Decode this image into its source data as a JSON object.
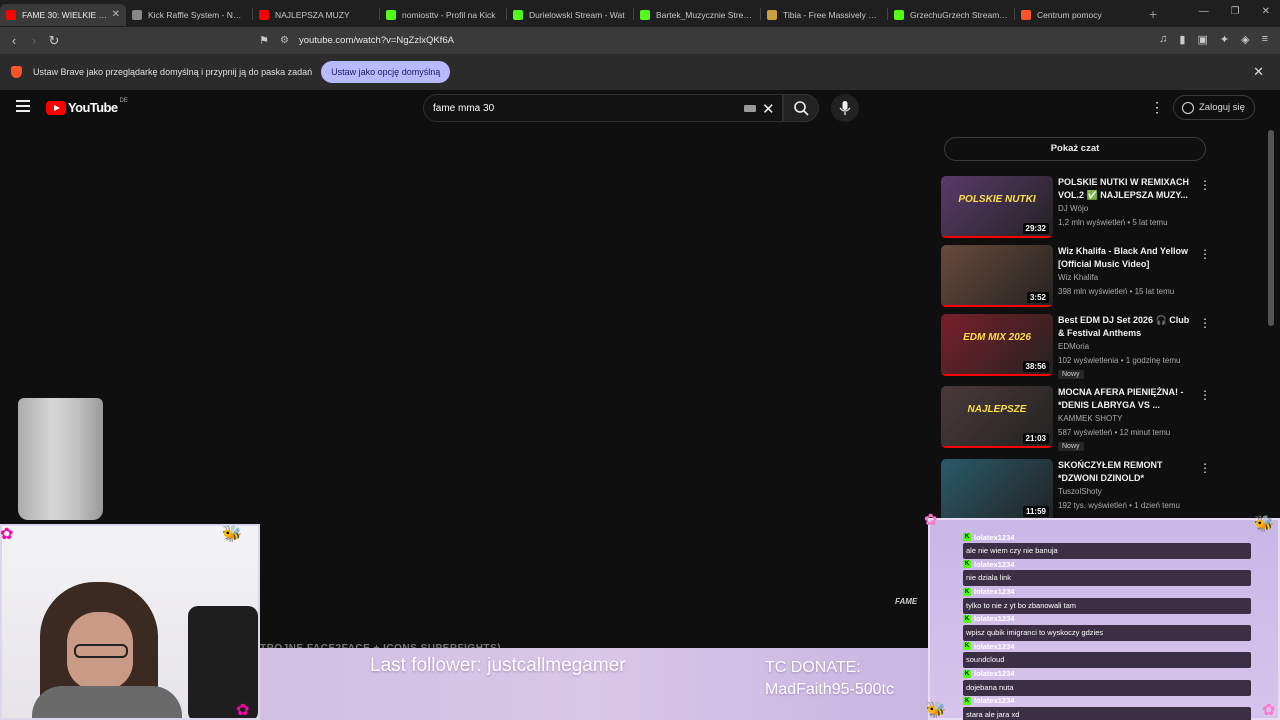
{
  "browser": {
    "tabs": [
      {
        "title": "FAME 30: WIELKIE OT",
        "color": "#ff0000",
        "active": true
      },
      {
        "title": "Kick Raffle System - Narzę",
        "color": "#888888"
      },
      {
        "title": "NAJLEPSZA MUZY",
        "color": "#ff0000"
      },
      {
        "title": "nomiosttv - Profil na Kick",
        "color": "#53fc18"
      },
      {
        "title": "Durielowski Stream - Wat",
        "color": "#53fc18"
      },
      {
        "title": "Bartek_Muzycznie Stream",
        "color": "#53fc18"
      },
      {
        "title": "Tibia - Free Massively Mul",
        "color": "#c8a13c"
      },
      {
        "title": "GrzechuGrzech Stream - W",
        "color": "#53fc18"
      },
      {
        "title": "Centrum pomocy",
        "color": "#fb542b"
      }
    ],
    "url": "youtube.com/watch?v=NgZzlxQKf6A",
    "shield_count": "1",
    "infobar_message": "Ustaw Brave jako przeglądarkę domyślną i przypnij ją do paska zadań",
    "infobar_button": "Ustaw jako opcję domyślną"
  },
  "youtube": {
    "logo_text": "YouTube",
    "country": "DE",
    "search_value": "fame mma 30",
    "signin_label": "Zaloguj się",
    "show_chat": "Pokaż czat",
    "recommendations": [
      {
        "title": "POLSKIE NUTKI W REMIXACH VOL.2 ✅ NAJLEPSZA MUZY...",
        "channel": "DJ Wójo",
        "meta": "1,2 mln wyświetleń • 5 lat temu",
        "duration": "29:32",
        "thumb": "#5a3a6a",
        "thumb_text": "POLSKIE NUTKI"
      },
      {
        "title": "Wiz Khalifa - Black And Yellow [Official Music Video]",
        "channel": "Wiz Khalifa",
        "meta": "398 mln wyświetleń • 15 lat temu",
        "duration": "3:52",
        "thumb": "#6a4a3a",
        "thumb_text": ""
      },
      {
        "title": "Best EDM DJ Set 2026 🎧 Club & Festival Anthems",
        "channel": "EDMoria",
        "meta": "102 wyświetlenia • 1 godzinę temu",
        "duration": "38:56",
        "badge": "Nowy",
        "thumb": "#7a1f2a",
        "thumb_text": "EDM MIX 2026"
      },
      {
        "title": "MOCNA AFERA PIENIĘŻNA! - *DENIS LABRYGA VS ...",
        "channel": "KAMMEK SHOTY",
        "meta": "587 wyświetleń • 12 minut temu",
        "duration": "21:03",
        "badge": "Nowy",
        "thumb": "#4a3a3a",
        "thumb_text": "NAJLEPSZE"
      },
      {
        "title": "SKOŃCZYŁEM REMONT *DZWONI DZINOLD*",
        "channel": "TuszolShoty",
        "meta": "192 tys. wyświetleń • 1 dzień temu",
        "duration": "11:59",
        "thumb": "#2a5a6a",
        "thumb_text": ""
      }
    ]
  },
  "stream": {
    "fame_mark": "FAME",
    "ticker": "TRÓJNE FACE2FACE + ICONS SUPERFIGHTS)",
    "last_follower": "Last follower: justcallmegamer",
    "donate_line1": "TC DONATE:",
    "donate_line2": "MadFaith95-500tc",
    "chat": [
      {
        "user": "lolatex1234",
        "msg": "ale nie wiem czy nie banuja"
      },
      {
        "user": "lolatex1234",
        "msg": "nie dziala link"
      },
      {
        "user": "lolatex1234",
        "msg": "tylko to nie z yt bo zbanowali tam"
      },
      {
        "user": "lolatex1234",
        "msg": "wpisz qubik imigranci to wyskoczy gdzies"
      },
      {
        "user": "lolatex1234",
        "msg": "soundcloud"
      },
      {
        "user": "lolatex1234",
        "msg": "dojebana nuta"
      },
      {
        "user": "lolatex1234",
        "msg": "stara ale jara xd"
      }
    ]
  }
}
